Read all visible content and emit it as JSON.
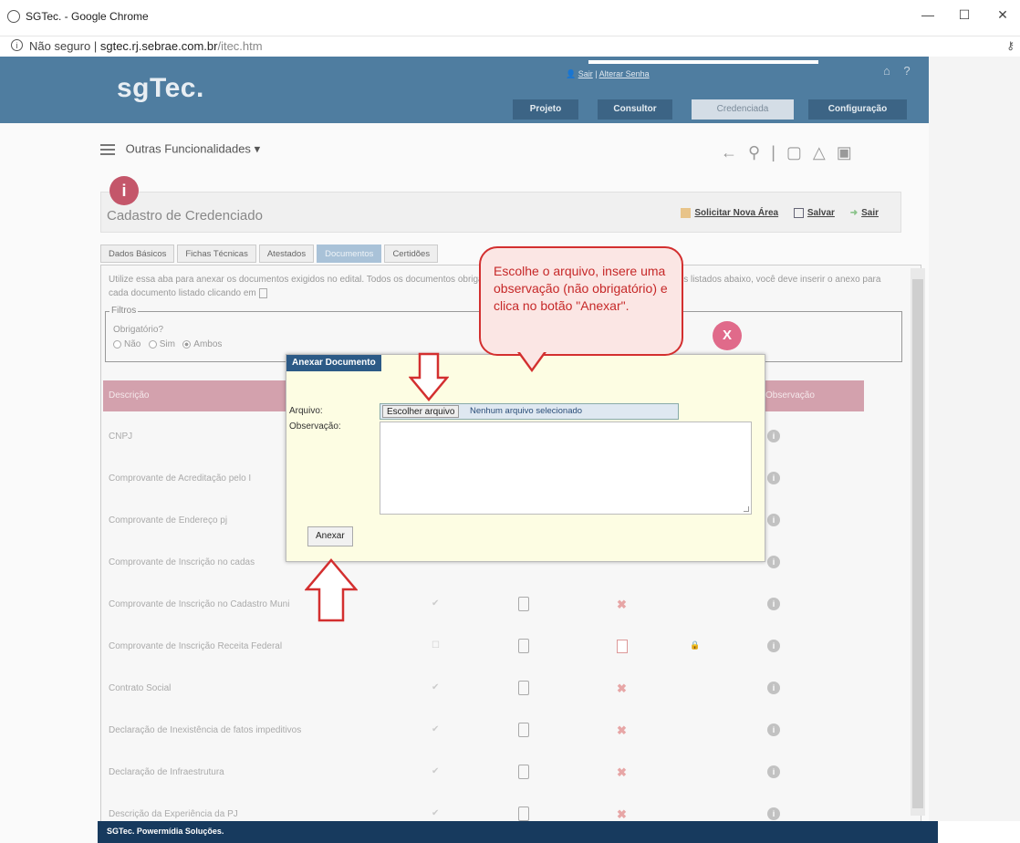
{
  "browser": {
    "window_title": "SGTec. - Google Chrome",
    "not_secure": "Não seguro",
    "separator": "|",
    "url_host": "sgtec.rj.sebrae.com.br",
    "url_path": "/itec.htm",
    "minimize": "—",
    "maximize": "☐",
    "close": "✕"
  },
  "header": {
    "logo": "sgTec.",
    "user_link_sair": "Sair",
    "user_link_sep": " | ",
    "user_link_senha": "Alterar Senha",
    "home_icon": "⌂",
    "help_icon": "?",
    "nav": [
      "Projeto",
      "Consultor",
      "Credenciada",
      "Configuração"
    ]
  },
  "funcbar": {
    "label": "Outras Funcionalidades",
    "caret": "▾"
  },
  "cadastro": {
    "info_icon": "i",
    "title": "Cadastro de Credenciado",
    "links": [
      "Solicitar Nova Área",
      "Salvar",
      "Sair"
    ]
  },
  "tabs": [
    "Dados Básicos",
    "Fichas Técnicas",
    "Atestados",
    "Documentos",
    "Certidões"
  ],
  "help_text": "Utilize essa aba para anexar os documentos exigidos no edital. Todos os documentos obrigatórios devem ser anexados e, para os documentos listados abaixo, você deve inserir o anexo para cada documento listado clicando em",
  "filtros": {
    "legend": "Filtros",
    "question": "Obrigatório?",
    "options": [
      "Não",
      "Sim",
      "Ambos"
    ]
  },
  "table": {
    "col_descricao": "Descrição",
    "col_observacao": "Observação",
    "rows": [
      "CNPJ",
      "Comprovante de Acreditação pelo I",
      "Comprovante de Endereço pj",
      "Comprovante de Inscrição no cadas",
      "Comprovante de Inscrição no Cadastro Muni",
      "Comprovante de Inscrição Receita Federal",
      "Contrato Social",
      "Declaração de Inexistência de fatos impeditivos",
      "Declaração de Infraestrutura",
      "Descrição da Experiência da PJ"
    ]
  },
  "footer": {
    "text": "SGTec. Powermídia Soluções."
  },
  "dialog": {
    "title": "Anexar Documento",
    "arquivo_label": "Arquivo:",
    "file_button": "Escolher arquivo",
    "file_status": "Nenhum arquivo selecionado",
    "observacao_label": "Observação:",
    "anexar_button": "Anexar"
  },
  "callout": {
    "text": "Escolhe o arquivo, insere uma observação (não obrigatório) e clica no botão \"Anexar\".",
    "close": "X"
  },
  "colors": {
    "header_bg": "#4f7da0",
    "dialog_bg": "#fdfde3",
    "dialog_title_bg": "#2c5a86",
    "callout_border": "#d32f2f",
    "footer_bg": "#173a5e"
  }
}
